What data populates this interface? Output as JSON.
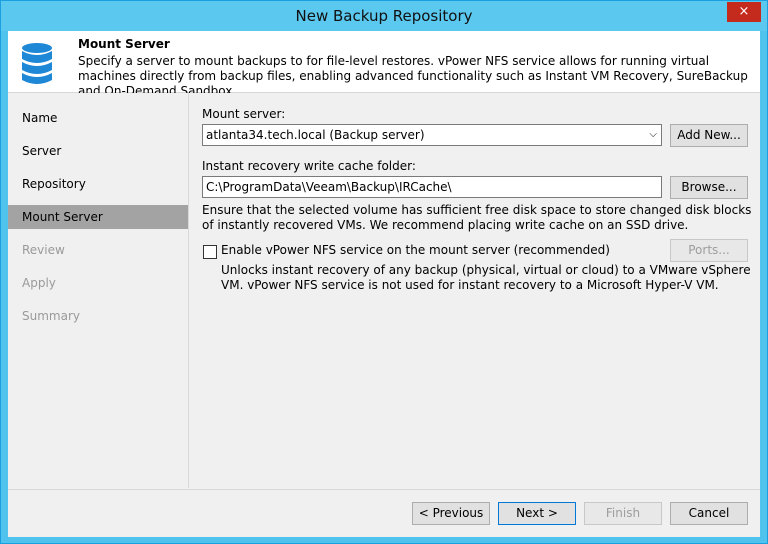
{
  "window": {
    "title": "New Backup Repository",
    "close_icon": "×"
  },
  "header": {
    "title": "Mount Server",
    "description": "Specify a server to mount backups to for file-level restores. vPower NFS service allows for running virtual machines directly from backup files, enabling advanced functionality such as Instant VM Recovery, SureBackup and On-Demand Sandbox."
  },
  "sidebar": {
    "items": [
      {
        "label": "Name",
        "state": "normal"
      },
      {
        "label": "Server",
        "state": "normal"
      },
      {
        "label": "Repository",
        "state": "normal"
      },
      {
        "label": "Mount Server",
        "state": "active"
      },
      {
        "label": "Review",
        "state": "disabled"
      },
      {
        "label": "Apply",
        "state": "disabled"
      },
      {
        "label": "Summary",
        "state": "disabled"
      }
    ]
  },
  "form": {
    "mount_server_label": "Mount server:",
    "mount_server_value": "atlanta34.tech.local (Backup server)",
    "add_new_label": "Add New...",
    "cache_folder_label": "Instant recovery write cache folder:",
    "cache_folder_value": "C:\\ProgramData\\Veeam\\Backup\\IRCache\\",
    "browse_label": "Browse...",
    "cache_note": "Ensure that the selected volume has sufficient free disk space to store changed disk blocks of instantly recovered VMs. We recommend placing write cache on an SSD drive.",
    "nfs_checkbox_label": "Enable vPower NFS service on the mount server (recommended)",
    "nfs_checked": false,
    "ports_label": "Ports...",
    "nfs_note": "Unlocks instant recovery of any backup (physical, virtual or cloud) to a VMware vSphere VM. vPower NFS service is not used for instant recovery to a Microsoft Hyper-V VM."
  },
  "footer": {
    "previous_label": "< Previous",
    "next_label": "Next >",
    "finish_label": "Finish",
    "cancel_label": "Cancel"
  },
  "colors": {
    "titlebar": "#5bc8f0",
    "active_nav": "#a3a3a3",
    "close": "#c42b1c",
    "icon": "#1e88d6"
  }
}
